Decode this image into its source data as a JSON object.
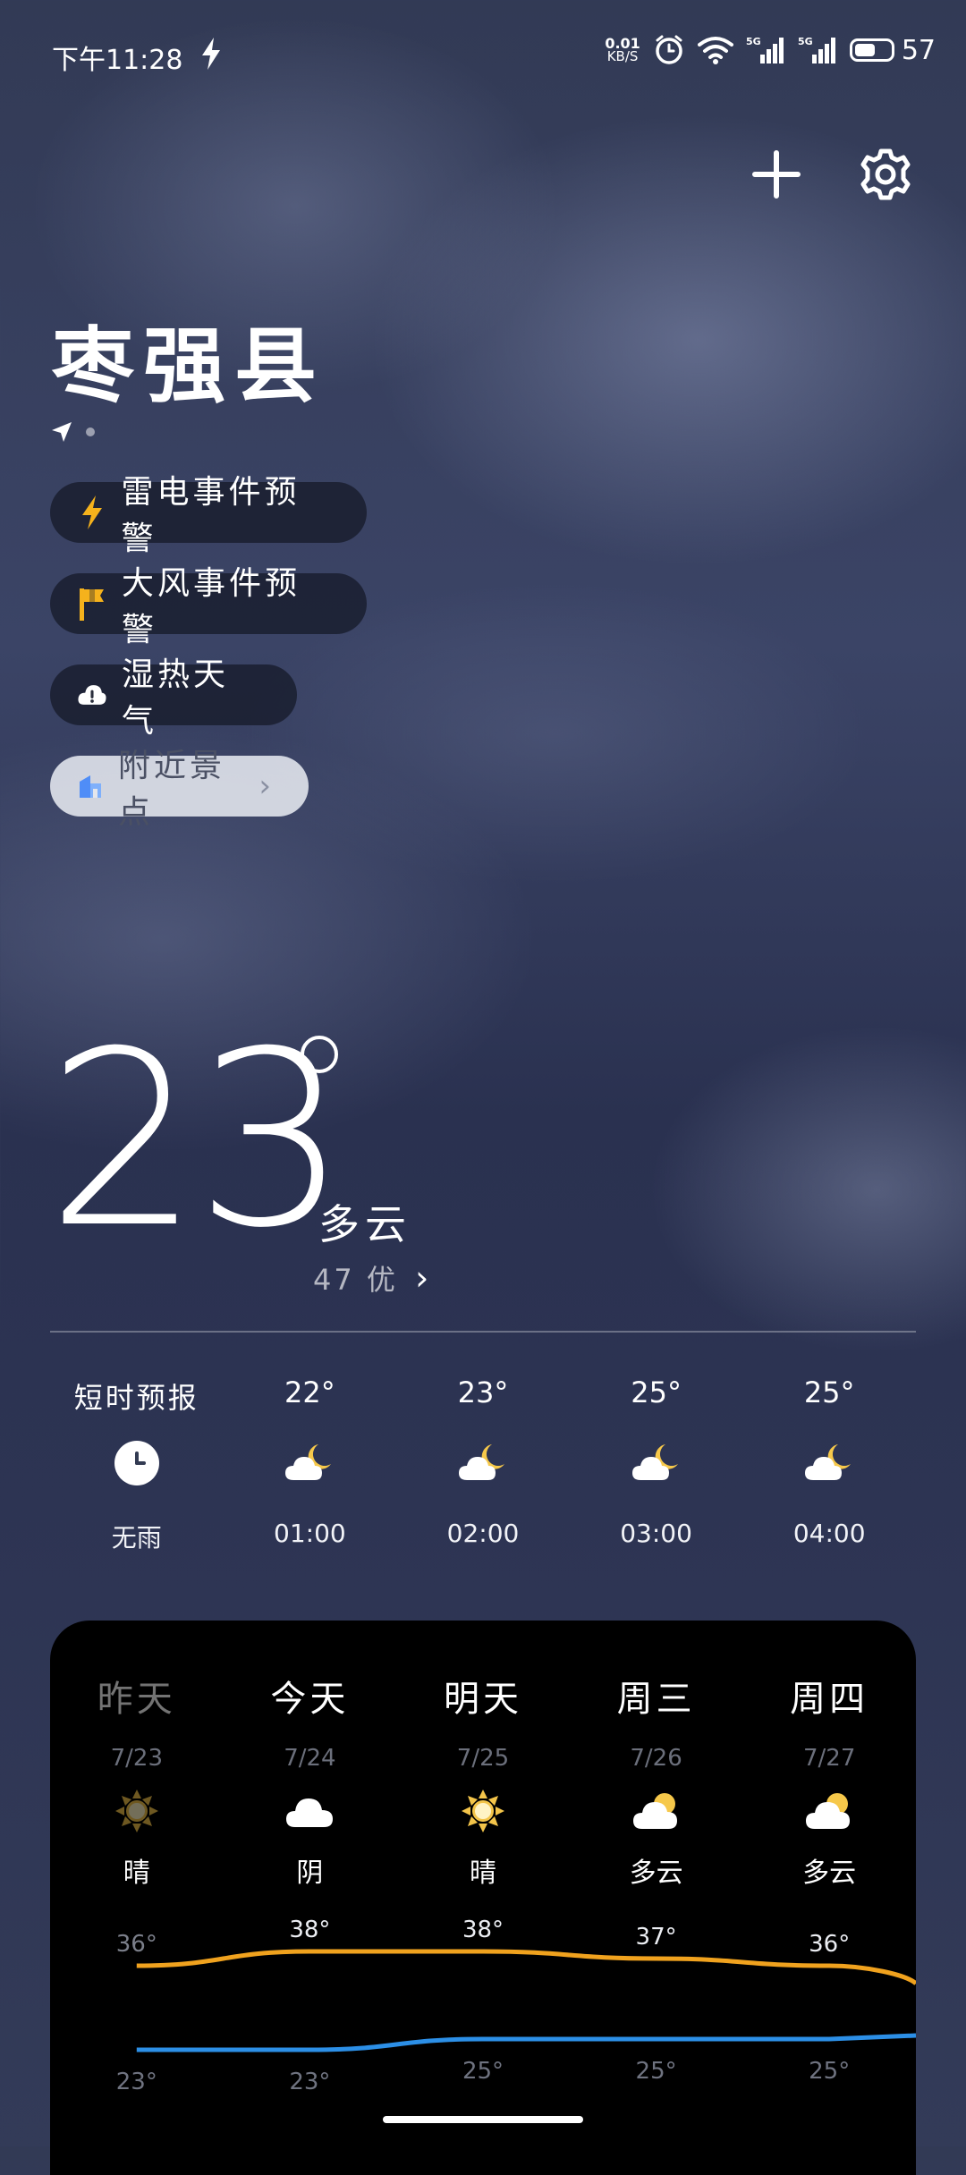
{
  "status_bar": {
    "time": "下午11:28",
    "net_speed_value": "0.01",
    "net_speed_unit": "KB/S",
    "battery_level": "57",
    "battery_fraction": 0.57
  },
  "location": {
    "city": "枣强县"
  },
  "alerts": [
    {
      "label": "雷电事件预警",
      "icon": "lightning-icon",
      "color": "#f5b21c"
    },
    {
      "label": "大风事件预警",
      "icon": "wind-flag-icon",
      "color": "#f5b21c"
    },
    {
      "label": "湿热天气",
      "icon": "warning-cloud-icon",
      "color": "#ffffff"
    }
  ],
  "nearby": {
    "label": "附近景点",
    "icon": "attraction-icon",
    "icon_color": "#4f8df7"
  },
  "current": {
    "temperature": "23",
    "condition": "多云",
    "aqi_text": "47 优"
  },
  "hourly": {
    "items": [
      {
        "top": "短时预报",
        "icon": "clock-icon",
        "bottom": "无雨"
      },
      {
        "top": "22°",
        "icon": "cloudy-night-icon",
        "bottom": "01:00"
      },
      {
        "top": "23°",
        "icon": "cloudy-night-icon",
        "bottom": "02:00"
      },
      {
        "top": "25°",
        "icon": "cloudy-night-icon",
        "bottom": "03:00"
      },
      {
        "top": "25°",
        "icon": "cloudy-night-icon",
        "bottom": "04:00"
      }
    ]
  },
  "daily": {
    "days": [
      {
        "name": "昨天",
        "date": "7/23",
        "icon": "sunny-icon",
        "condition": "晴",
        "high": 36,
        "low": 23,
        "high_label": "36°",
        "low_label": "23°"
      },
      {
        "name": "今天",
        "date": "7/24",
        "icon": "overcast-icon",
        "condition": "阴",
        "high": 38,
        "low": 23,
        "high_label": "38°",
        "low_label": "23°"
      },
      {
        "name": "明天",
        "date": "7/25",
        "icon": "sunny-icon",
        "condition": "晴",
        "high": 38,
        "low": 25,
        "high_label": "38°",
        "low_label": "25°"
      },
      {
        "name": "周三",
        "date": "7/26",
        "icon": "partly-cloudy-icon",
        "condition": "多云",
        "high": 37,
        "low": 25,
        "high_label": "37°",
        "low_label": "25°"
      },
      {
        "name": "周四",
        "date": "7/27",
        "icon": "partly-cloudy-icon",
        "condition": "多云",
        "high": 36,
        "low": 25,
        "high_label": "36°",
        "low_label": "25°"
      }
    ],
    "colors": {
      "high_line": "#f0a21e",
      "low_line": "#2c8fe6"
    }
  }
}
